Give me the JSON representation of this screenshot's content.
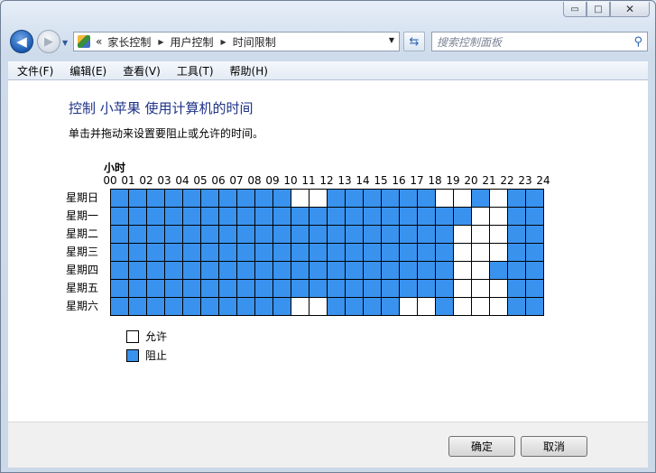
{
  "window": {
    "controls": {
      "minimize": "▭",
      "maximize": "□",
      "close": "✕"
    }
  },
  "nav": {
    "breadcrumb_overflow": "«",
    "breadcrumb": [
      "家长控制",
      "用户控制",
      "时间限制"
    ],
    "search_placeholder": "搜索控制面板"
  },
  "menu": [
    "文件(F)",
    "编辑(E)",
    "查看(V)",
    "工具(T)",
    "帮助(H)"
  ],
  "page": {
    "title": "控制 小苹果 使用计算机的时间",
    "description": "单击并拖动来设置要阻止或允许的时间。",
    "hours_label": "小时"
  },
  "grid": {
    "hours": [
      "00",
      "01",
      "02",
      "03",
      "04",
      "05",
      "06",
      "07",
      "08",
      "09",
      "10",
      "11",
      "12",
      "13",
      "14",
      "15",
      "16",
      "17",
      "18",
      "19",
      "20",
      "21",
      "22",
      "23",
      "24"
    ],
    "days": [
      {
        "label": "星期日",
        "cells": "111111111100111111001011"
      },
      {
        "label": "星期一",
        "cells": "111111111111111111110011"
      },
      {
        "label": "星期二",
        "cells": "111111111111111111100011"
      },
      {
        "label": "星期三",
        "cells": "111111111111111111100011"
      },
      {
        "label": "星期四",
        "cells": "111111111111111111100111"
      },
      {
        "label": "星期五",
        "cells": "111111111111111111100011"
      },
      {
        "label": "星期六",
        "cells": "111111111100111100100011"
      }
    ],
    "colors": {
      "blocked": "#3992ee",
      "allowed": "#ffffff"
    }
  },
  "legend": {
    "allowed": "允许",
    "blocked": "阻止"
  },
  "buttons": {
    "ok": "确定",
    "cancel": "取消"
  }
}
